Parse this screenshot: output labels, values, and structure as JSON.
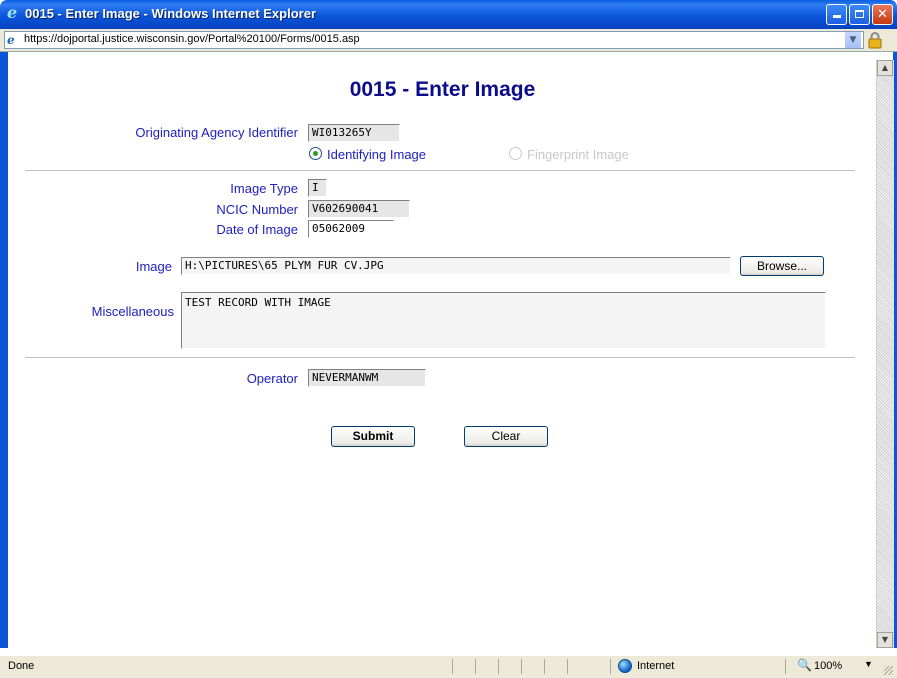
{
  "window": {
    "title": "0015 - Enter Image - Windows Internet Explorer",
    "controls": {
      "minimize": "_",
      "maximize": "□",
      "close": "✕"
    }
  },
  "address": {
    "url": "https://dojportal.justice.wisconsin.gov/Portal%20100/Forms/0015.asp"
  },
  "form": {
    "title": "0015 - Enter Image",
    "ori_label": "Originating Agency Identifier",
    "ori_value": "WI013265Y",
    "image_kind_options": [
      {
        "label": "Identifying Image",
        "selected": true
      },
      {
        "label": "Fingerprint Image",
        "selected": false
      }
    ],
    "image_type_label": "Image Type",
    "image_type_value": "I",
    "ncic_label": "NCIC Number",
    "ncic_value": "V602690041",
    "date_label": "Date of Image",
    "date_value": "05062009",
    "image_label": "Image",
    "image_value": "H:\\PICTURES\\65 PLYM FUR CV.JPG",
    "browse_label": "Browse...",
    "misc_label": "Miscellaneous",
    "misc_value": "TEST RECORD WITH IMAGE",
    "operator_label": "Operator",
    "operator_value": "NEVERMANWM",
    "submit_label": "Submit",
    "clear_label": "Clear"
  },
  "statusbar": {
    "status": "Done",
    "zone": "Internet",
    "zoom": "100%"
  },
  "colors": {
    "title_blue": "#0b0b8c",
    "label_blue": "#2020c0",
    "xp_blue": "#0b55d8"
  }
}
